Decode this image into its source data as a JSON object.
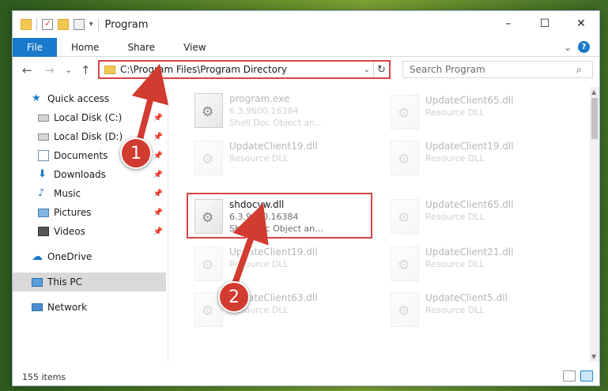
{
  "window": {
    "title": "Program",
    "controls": {
      "minimize": "–",
      "maximize": "☐",
      "close": "✕"
    }
  },
  "ribbon": {
    "file": "File",
    "tabs": [
      "Home",
      "Share",
      "View"
    ],
    "collapse": "⌄",
    "help": "?"
  },
  "nav": {
    "back": "←",
    "forward": "→",
    "recent": "⌄",
    "up": "↑",
    "address": "C:\\Program Files\\Program Directory",
    "address_dropdown": "⌄",
    "refresh": "↻",
    "search_placeholder": "Search Program",
    "search_icon": "⌕"
  },
  "sidebar": {
    "quick_access": "Quick access",
    "items": [
      {
        "label": "Local Disk (C:)",
        "icon": "drive-icon",
        "pinned": true
      },
      {
        "label": "Local Disk (D:)",
        "icon": "drive-icon",
        "pinned": true
      },
      {
        "label": "Documents",
        "icon": "documents-icon",
        "pinned": true
      },
      {
        "label": "Downloads",
        "icon": "downloads-icon",
        "pinned": true
      },
      {
        "label": "Music",
        "icon": "music-icon",
        "pinned": true
      },
      {
        "label": "Pictures",
        "icon": "pictures-icon",
        "pinned": true
      },
      {
        "label": "Videos",
        "icon": "videos-icon",
        "pinned": true
      }
    ],
    "onedrive": "OneDrive",
    "this_pc": "This PC",
    "network": "Network",
    "pin_glyph": "📌"
  },
  "files": {
    "left": [
      {
        "name": "program.exe",
        "meta1": "6.3.9600.16384",
        "meta2": "Shell Doc Object an..."
      },
      {
        "name": "UpdateClient19.dll",
        "meta1": "Resource DLL",
        "meta2": ""
      },
      {
        "name": "shdocvw.dll",
        "meta1": "6.3.9600.16384",
        "meta2": "Shell Doc Object an...",
        "selected": true
      },
      {
        "name": "UpdateClient19.dll",
        "meta1": "Resource DLL",
        "meta2": ""
      },
      {
        "name": "UpdateClient63.dll",
        "meta1": "Resource DLL",
        "meta2": ""
      }
    ],
    "right": [
      {
        "name": "UpdateClient65.dll",
        "meta1": "Resource DLL"
      },
      {
        "name": "UpdateClient19.dll",
        "meta1": "Resource DLL"
      },
      {
        "name": "UpdateClient65.dll",
        "meta1": "Resource DLL"
      },
      {
        "name": "UpdateClient21.dll",
        "meta1": "Resource DLL"
      },
      {
        "name": "UpdateClient5.dll",
        "meta1": "Resource DLL"
      }
    ]
  },
  "status": {
    "items": "155 items"
  },
  "annotations": {
    "step1": "1",
    "step2": "2"
  },
  "colors": {
    "accent": "#1979ca",
    "highlight": "#d64545",
    "selection": "#d9d9d9"
  }
}
